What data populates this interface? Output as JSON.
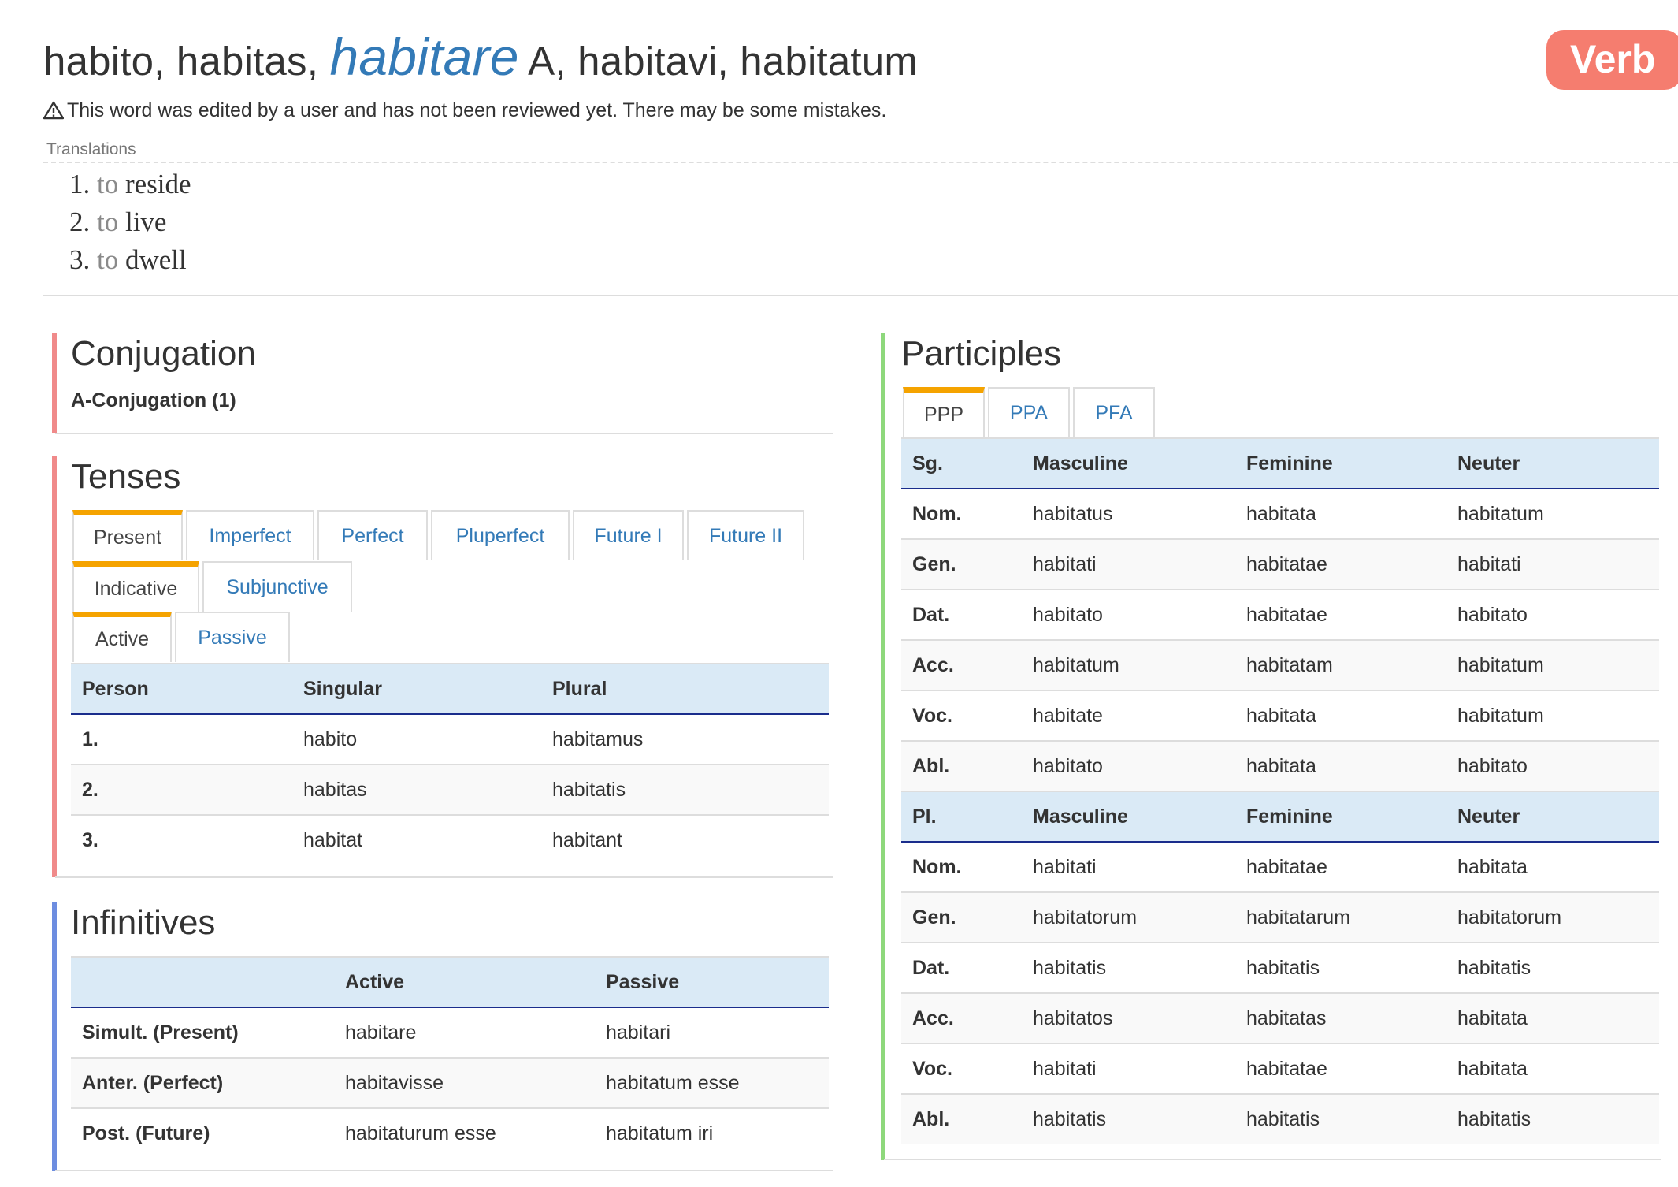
{
  "header": {
    "forms_before": "habito, habitas,",
    "infinitive": "habitare",
    "forms_after": "A, habitavi, habitatum",
    "badge": "Verb",
    "warning": "This word was edited by a user and has not been reviewed yet. There may be some mistakes."
  },
  "translations": {
    "label": "Translations",
    "items": [
      {
        "num": "1.",
        "to": "to",
        "word": "reside"
      },
      {
        "num": "2.",
        "to": "to",
        "word": "live"
      },
      {
        "num": "3.",
        "to": "to",
        "word": "dwell"
      }
    ]
  },
  "conjugation": {
    "title": "Conjugation",
    "value": "A-Conjugation (1)"
  },
  "tenses": {
    "title": "Tenses",
    "tense_tabs": [
      "Present",
      "Imperfect",
      "Perfect",
      "Pluperfect",
      "Future I",
      "Future II"
    ],
    "mood_tabs": [
      "Indicative",
      "Subjunctive"
    ],
    "voice_tabs": [
      "Active",
      "Passive"
    ],
    "columns": [
      "Person",
      "Singular",
      "Plural"
    ],
    "rows": [
      [
        "1.",
        "habito",
        "habitamus"
      ],
      [
        "2.",
        "habitas",
        "habitatis"
      ],
      [
        "3.",
        "habitat",
        "habitant"
      ]
    ]
  },
  "infinitives": {
    "title": "Infinitives",
    "columns": [
      "",
      "Active",
      "Passive"
    ],
    "rows": [
      [
        "Simult. (Present)",
        "habitare",
        "habitari"
      ],
      [
        "Anter. (Perfect)",
        "habitavisse",
        "habitatum esse"
      ],
      [
        "Post. (Future)",
        "habitaturum esse",
        "habitatum iri"
      ]
    ]
  },
  "participles": {
    "title": "Participles",
    "tabs": [
      "PPP",
      "PPA",
      "PFA"
    ],
    "sg_header": [
      "Sg.",
      "Masculine",
      "Feminine",
      "Neuter"
    ],
    "sg_rows": [
      [
        "Nom.",
        "habitatus",
        "habitata",
        "habitatum"
      ],
      [
        "Gen.",
        "habitati",
        "habitatae",
        "habitati"
      ],
      [
        "Dat.",
        "habitato",
        "habitatae",
        "habitato"
      ],
      [
        "Acc.",
        "habitatum",
        "habitatam",
        "habitatum"
      ],
      [
        "Voc.",
        "habitate",
        "habitata",
        "habitatum"
      ],
      [
        "Abl.",
        "habitato",
        "habitata",
        "habitato"
      ]
    ],
    "pl_header": [
      "Pl.",
      "Masculine",
      "Feminine",
      "Neuter"
    ],
    "pl_rows": [
      [
        "Nom.",
        "habitati",
        "habitatae",
        "habitata"
      ],
      [
        "Gen.",
        "habitatorum",
        "habitatarum",
        "habitatorum"
      ],
      [
        "Dat.",
        "habitatis",
        "habitatis",
        "habitatis"
      ],
      [
        "Acc.",
        "habitatos",
        "habitatas",
        "habitata"
      ],
      [
        "Voc.",
        "habitati",
        "habitatae",
        "habitata"
      ],
      [
        "Abl.",
        "habitatis",
        "habitatis",
        "habitatis"
      ]
    ]
  }
}
